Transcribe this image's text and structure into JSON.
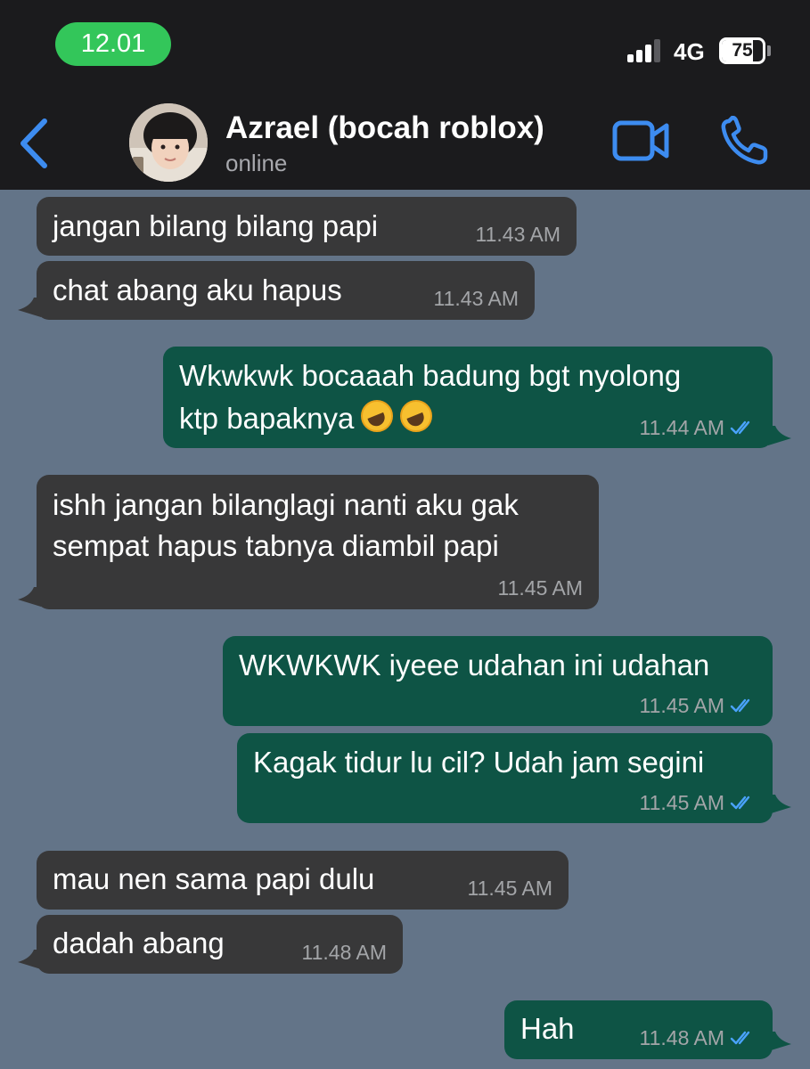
{
  "status_bar": {
    "time": "12.01",
    "network": "4G",
    "battery": "75"
  },
  "header": {
    "contact_name": "Azrael (bocah roblox)",
    "contact_status": "online",
    "icons": {
      "back": "chevron-left-icon",
      "video": "video-camera-icon",
      "call": "phone-icon"
    }
  },
  "colors": {
    "header_bg": "#1b1b1d",
    "chat_bg": "#637488",
    "incoming_bubble": "#383839",
    "outgoing_bubble": "#0e5445",
    "accent_blue": "#3d8cf0",
    "time_pill": "#33c65a"
  },
  "messages": [
    {
      "dir": "in",
      "lines": [
        "jangan bilang bilang papi"
      ],
      "time": "11.43 AM"
    },
    {
      "dir": "in",
      "lines": [
        "chat abang aku hapus"
      ],
      "time": "11.43 AM"
    },
    {
      "dir": "out",
      "lines": [
        "Wkwkwk bocaaah badung bgt nyolong",
        "ktp bapaknya"
      ],
      "time": "11.44 AM",
      "read": true,
      "emoji": "rolling-on-floor-laughing x2"
    },
    {
      "dir": "in",
      "lines": [
        "ishh jangan bilanglagi nanti aku gak",
        "sempat hapus tabnya diambil papi"
      ],
      "time": "11.45 AM"
    },
    {
      "dir": "out",
      "lines": [
        "WKWKWK iyeee udahan ini udahan"
      ],
      "time": "11.45 AM",
      "read": true
    },
    {
      "dir": "out",
      "lines": [
        "Kagak tidur lu cil? Udah jam segini"
      ],
      "time": "11.45 AM",
      "read": true
    },
    {
      "dir": "in",
      "lines": [
        "mau nen sama papi dulu"
      ],
      "time": "11.45 AM"
    },
    {
      "dir": "in",
      "lines": [
        "dadah abang"
      ],
      "time": "11.48 AM"
    },
    {
      "dir": "out",
      "lines": [
        "Hah"
      ],
      "time": "11.48 AM",
      "read": true
    }
  ]
}
